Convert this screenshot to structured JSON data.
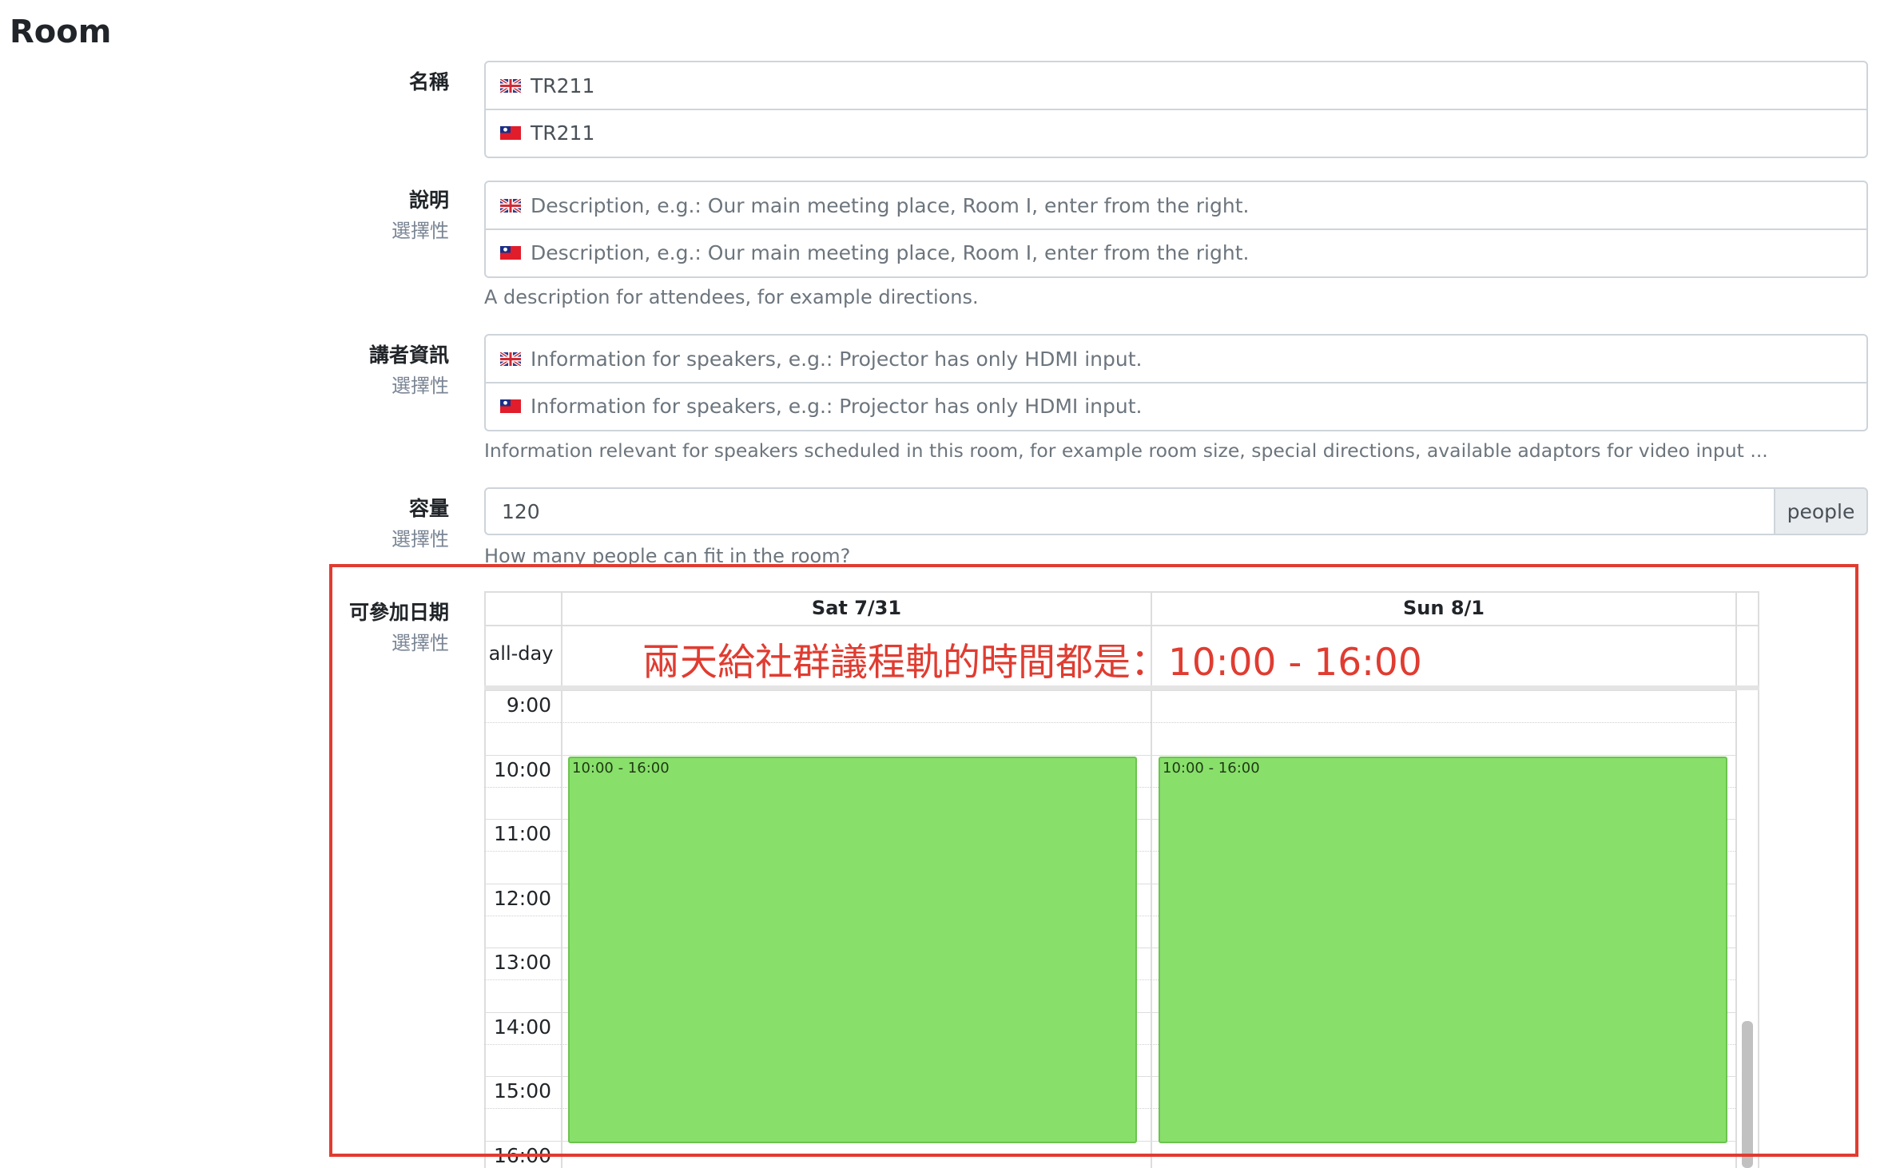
{
  "page": {
    "title": "Room"
  },
  "form": {
    "name": {
      "label": "名稱",
      "values": [
        "TR211",
        "TR211"
      ]
    },
    "description": {
      "label": "說明",
      "optional": "選擇性",
      "placeholders": [
        "Description, e.g.: Our main meeting place, Room I, enter from the right.",
        "Description, e.g.: Our main meeting place, Room I, enter from the right."
      ],
      "help": "A description for attendees, for example directions."
    },
    "speaker_info": {
      "label": "講者資訊",
      "optional": "選擇性",
      "placeholders": [
        "Information for speakers, e.g.: Projector has only HDMI input.",
        "Information for speakers, e.g.: Projector has only HDMI input."
      ],
      "help": "Information relevant for speakers scheduled in this room, for example room size, special directions, available adaptors for video input ..."
    },
    "capacity": {
      "label": "容量",
      "optional": "選擇性",
      "value": "120",
      "addon": "people",
      "help": "How many people can fit in the room?"
    },
    "availability": {
      "label": "可參加日期",
      "optional": "選擇性",
      "all_day_label": "all-day",
      "days": [
        {
          "header": "Sat 7/31",
          "event": "10:00 - 16:00"
        },
        {
          "header": "Sun 8/1",
          "event": "10:00 - 16:00"
        }
      ],
      "hours": [
        "9:00",
        "10:00",
        "11:00",
        "12:00",
        "13:00",
        "14:00",
        "15:00",
        "16:00"
      ]
    }
  },
  "annotation": {
    "text": "兩天給社群議程軌的時間都是：10:00 - 16:00",
    "color": "#e03c31"
  },
  "colors": {
    "event_fill": "#88e06b",
    "event_border": "#6cc34f",
    "input_border": "#ced4da",
    "addon_bg": "#e9ecef"
  },
  "icons": [
    "uk-flag-icon",
    "taiwan-flag-icon"
  ]
}
